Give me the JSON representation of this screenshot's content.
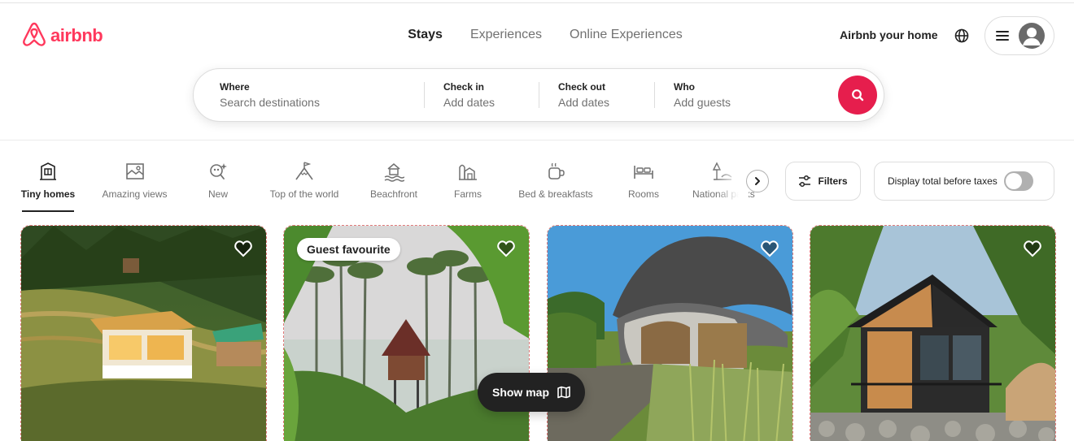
{
  "brand": {
    "name": "airbnb",
    "color": "#ff385c"
  },
  "nav": {
    "tabs": [
      {
        "label": "Stays",
        "active": true
      },
      {
        "label": "Experiences",
        "active": false
      },
      {
        "label": "Online Experiences",
        "active": false
      }
    ]
  },
  "header": {
    "host_link": "Airbnb your home",
    "globe_icon": "globe-icon",
    "menu_icon": "hamburger-icon",
    "avatar_icon": "user-avatar-icon"
  },
  "search": {
    "where_label": "Where",
    "where_placeholder": "Search destinations",
    "checkin_label": "Check in",
    "checkin_value": "Add dates",
    "checkout_label": "Check out",
    "checkout_value": "Add dates",
    "who_label": "Who",
    "who_value": "Add guests",
    "button_color": "#e61e4d",
    "button_icon": "magnifier-icon"
  },
  "categories": [
    {
      "label": "Tiny homes",
      "icon": "tiny-home-icon",
      "active": true
    },
    {
      "label": "Amazing views",
      "icon": "amazing-views-icon",
      "active": false
    },
    {
      "label": "New",
      "icon": "new-icon",
      "active": false
    },
    {
      "label": "Top of the world",
      "icon": "mountain-flag-icon",
      "active": false
    },
    {
      "label": "Beachfront",
      "icon": "beach-icon",
      "active": false
    },
    {
      "label": "Farms",
      "icon": "farm-icon",
      "active": false
    },
    {
      "label": "Bed & breakfasts",
      "icon": "coffee-cup-icon",
      "active": false
    },
    {
      "label": "Rooms",
      "icon": "bed-icon",
      "active": false
    },
    {
      "label": "National parks",
      "icon": "park-icon",
      "active": false
    }
  ],
  "filters": {
    "label": "Filters",
    "icon": "sliders-icon",
    "taxes_label": "Display total before taxes",
    "taxes_toggle_on": false
  },
  "listings": [
    {
      "badge": "",
      "photo": "hillside-tiny-house-photo",
      "favourite": false
    },
    {
      "badge": "Guest favourite",
      "photo": "treehouse-palm-forest-photo",
      "favourite": false
    },
    {
      "badge": "",
      "photo": "dome-hut-photo",
      "favourite": false
    },
    {
      "badge": "",
      "photo": "a-frame-cabin-photo",
      "favourite": false
    }
  ],
  "show_map": {
    "label": "Show map",
    "icon": "map-icon"
  }
}
